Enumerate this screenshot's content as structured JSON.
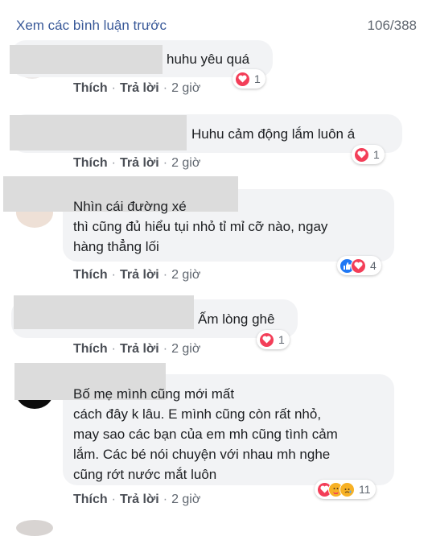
{
  "header": {
    "prev_link": "Xem các bình luận trước",
    "count": "106/388"
  },
  "actions": {
    "like": "Thích",
    "reply": "Trả lời",
    "sep": "·"
  },
  "comments": [
    {
      "text": "huhu yêu quá",
      "time": "2 giờ",
      "reactions": [
        "love"
      ],
      "reaction_count": "1"
    },
    {
      "text": "Huhu cảm động lắm luôn á",
      "time": "2 giờ",
      "reactions": [
        "love"
      ],
      "reaction_count": "1"
    },
    {
      "text": "Nhìn cái đường xé\nthì cũng đủ hiểu tụi nhỏ tỉ mỉ cỡ nào, ngay\nhàng thẳng lối",
      "time": "2 giờ",
      "reactions": [
        "like",
        "love"
      ],
      "reaction_count": "4"
    },
    {
      "text": "Ấm lòng ghê",
      "time": "2 giờ",
      "reactions": [
        "love"
      ],
      "reaction_count": "1"
    },
    {
      "text": "Bố mẹ mình cũng mới mất\ncách đây k lâu. E mình cũng còn rất nhỏ,\nmay sao các bạn của em mh cũng tình cảm\nlắm. Các bé nói chuyện với nhau mh nghe\ncũng rớt nước mắt luôn",
      "time": "2 giờ",
      "reactions": [
        "love",
        "care",
        "sad"
      ],
      "reaction_count": "11"
    }
  ],
  "colors": {
    "link": "#385898",
    "bubble": "#f2f3f5",
    "love": "#f33e58",
    "like": "#2078f4",
    "meta": "#606770"
  },
  "icons": {
    "love": "heart-icon",
    "like": "thumbs-up-icon",
    "care": "care-emoji-icon",
    "sad": "sad-emoji-icon"
  }
}
